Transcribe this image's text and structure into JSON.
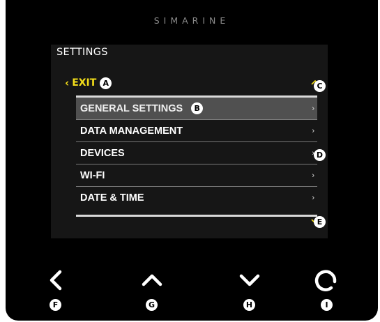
{
  "brand": "SIMARINE",
  "screen": {
    "title": "SETTINGS",
    "exit_label": "EXIT",
    "menu": [
      {
        "label": "GENERAL SETTINGS",
        "selected": true
      },
      {
        "label": "DATA MANAGEMENT",
        "selected": false
      },
      {
        "label": "DEVICES",
        "selected": false
      },
      {
        "label": "WI-FI",
        "selected": false
      },
      {
        "label": "DATE & TIME",
        "selected": false
      }
    ],
    "row_arrow": "›"
  },
  "callouts": {
    "a": "A",
    "b": "B",
    "c": "C",
    "d": "D",
    "e": "E",
    "f": "F",
    "g": "G",
    "h": "H",
    "i": "I"
  },
  "colors": {
    "accent": "#f3dd1a",
    "selected_row": "#505050",
    "background": "#000000"
  },
  "buttons": {
    "back": "chevron-left-icon",
    "up": "chevron-up-icon",
    "down": "chevron-down-icon",
    "select": "ring-icon"
  }
}
